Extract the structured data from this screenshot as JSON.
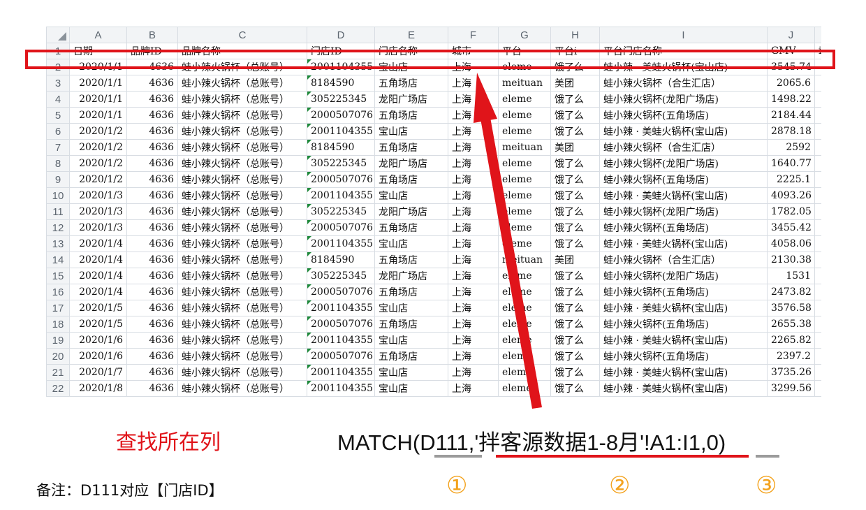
{
  "columns": [
    "A",
    "B",
    "C",
    "D",
    "E",
    "F",
    "G",
    "H",
    "I",
    "J"
  ],
  "header_row": {
    "num": "1",
    "cells": [
      "日期",
      "品牌ID",
      "品牌名称",
      "门店ID",
      "门店名称",
      "城市",
      "平台",
      "平台i",
      "平台门店名称",
      "GMV",
      "i"
    ]
  },
  "rows": [
    {
      "num": "2",
      "date": "2020/1/1",
      "brand_id": "4636",
      "brand": "蛙小辣火锅杯（总账号）",
      "store_id": "2001104355",
      "store": "宝山店",
      "city": "上海",
      "platform": "eleme",
      "platform_cn": "饿了么",
      "platform_store": "蛙小辣 · 美蛙火锅杯(宝山店)",
      "gmv": "3545.74"
    },
    {
      "num": "3",
      "date": "2020/1/1",
      "brand_id": "4636",
      "brand": "蛙小辣火锅杯（总账号）",
      "store_id": "8184590",
      "store": "五角场店",
      "city": "上海",
      "platform": "meituan",
      "platform_cn": "美团",
      "platform_store": "蛙小辣火锅杯（合生汇店）",
      "gmv": "2065.6"
    },
    {
      "num": "4",
      "date": "2020/1/1",
      "brand_id": "4636",
      "brand": "蛙小辣火锅杯（总账号）",
      "store_id": "305225345",
      "store": "龙阳广场店",
      "city": "上海",
      "platform": "eleme",
      "platform_cn": "饿了么",
      "platform_store": "蛙小辣火锅杯(龙阳广场店)",
      "gmv": "1498.22"
    },
    {
      "num": "5",
      "date": "2020/1/1",
      "brand_id": "4636",
      "brand": "蛙小辣火锅杯（总账号）",
      "store_id": "2000507076",
      "store": "五角场店",
      "city": "上海",
      "platform": "eleme",
      "platform_cn": "饿了么",
      "platform_store": "蛙小辣火锅杯(五角场店)",
      "gmv": "2184.44"
    },
    {
      "num": "6",
      "date": "2020/1/2",
      "brand_id": "4636",
      "brand": "蛙小辣火锅杯（总账号）",
      "store_id": "2001104355",
      "store": "宝山店",
      "city": "上海",
      "platform": "eleme",
      "platform_cn": "饿了么",
      "platform_store": "蛙小辣 · 美蛙火锅杯(宝山店)",
      "gmv": "2878.18"
    },
    {
      "num": "7",
      "date": "2020/1/2",
      "brand_id": "4636",
      "brand": "蛙小辣火锅杯（总账号）",
      "store_id": "8184590",
      "store": "五角场店",
      "city": "上海",
      "platform": "meituan",
      "platform_cn": "美团",
      "platform_store": "蛙小辣火锅杯（合生汇店）",
      "gmv": "2592"
    },
    {
      "num": "8",
      "date": "2020/1/2",
      "brand_id": "4636",
      "brand": "蛙小辣火锅杯（总账号）",
      "store_id": "305225345",
      "store": "龙阳广场店",
      "city": "上海",
      "platform": "eleme",
      "platform_cn": "饿了么",
      "platform_store": "蛙小辣火锅杯(龙阳广场店)",
      "gmv": "1640.77"
    },
    {
      "num": "9",
      "date": "2020/1/2",
      "brand_id": "4636",
      "brand": "蛙小辣火锅杯（总账号）",
      "store_id": "2000507076",
      "store": "五角场店",
      "city": "上海",
      "platform": "eleme",
      "platform_cn": "饿了么",
      "platform_store": "蛙小辣火锅杯(五角场店)",
      "gmv": "2225.1"
    },
    {
      "num": "10",
      "date": "2020/1/3",
      "brand_id": "4636",
      "brand": "蛙小辣火锅杯（总账号）",
      "store_id": "2001104355",
      "store": "宝山店",
      "city": "上海",
      "platform": "eleme",
      "platform_cn": "饿了么",
      "platform_store": "蛙小辣 · 美蛙火锅杯(宝山店)",
      "gmv": "4093.26"
    },
    {
      "num": "11",
      "date": "2020/1/3",
      "brand_id": "4636",
      "brand": "蛙小辣火锅杯（总账号）",
      "store_id": "305225345",
      "store": "龙阳广场店",
      "city": "上海",
      "platform": "eleme",
      "platform_cn": "饿了么",
      "platform_store": "蛙小辣火锅杯(龙阳广场店)",
      "gmv": "1782.05"
    },
    {
      "num": "12",
      "date": "2020/1/3",
      "brand_id": "4636",
      "brand": "蛙小辣火锅杯（总账号）",
      "store_id": "2000507076",
      "store": "五角场店",
      "city": "上海",
      "platform": "eleme",
      "platform_cn": "饿了么",
      "platform_store": "蛙小辣火锅杯(五角场店)",
      "gmv": "3455.42"
    },
    {
      "num": "13",
      "date": "2020/1/4",
      "brand_id": "4636",
      "brand": "蛙小辣火锅杯（总账号）",
      "store_id": "2001104355",
      "store": "宝山店",
      "city": "上海",
      "platform": "eleme",
      "platform_cn": "饿了么",
      "platform_store": "蛙小辣 · 美蛙火锅杯(宝山店)",
      "gmv": "4058.06"
    },
    {
      "num": "14",
      "date": "2020/1/4",
      "brand_id": "4636",
      "brand": "蛙小辣火锅杯（总账号）",
      "store_id": "8184590",
      "store": "五角场店",
      "city": "上海",
      "platform": "meituan",
      "platform_cn": "美团",
      "platform_store": "蛙小辣火锅杯（合生汇店）",
      "gmv": "2130.38"
    },
    {
      "num": "15",
      "date": "2020/1/4",
      "brand_id": "4636",
      "brand": "蛙小辣火锅杯（总账号）",
      "store_id": "305225345",
      "store": "龙阳广场店",
      "city": "上海",
      "platform": "eleme",
      "platform_cn": "饿了么",
      "platform_store": "蛙小辣火锅杯(龙阳广场店)",
      "gmv": "1531"
    },
    {
      "num": "16",
      "date": "2020/1/4",
      "brand_id": "4636",
      "brand": "蛙小辣火锅杯（总账号）",
      "store_id": "2000507076",
      "store": "五角场店",
      "city": "上海",
      "platform": "eleme",
      "platform_cn": "饿了么",
      "platform_store": "蛙小辣火锅杯(五角场店)",
      "gmv": "2473.82"
    },
    {
      "num": "17",
      "date": "2020/1/5",
      "brand_id": "4636",
      "brand": "蛙小辣火锅杯（总账号）",
      "store_id": "2001104355",
      "store": "宝山店",
      "city": "上海",
      "platform": "eleme",
      "platform_cn": "饿了么",
      "platform_store": "蛙小辣 · 美蛙火锅杯(宝山店)",
      "gmv": "3576.58"
    },
    {
      "num": "18",
      "date": "2020/1/5",
      "brand_id": "4636",
      "brand": "蛙小辣火锅杯（总账号）",
      "store_id": "2000507076",
      "store": "五角场店",
      "city": "上海",
      "platform": "eleme",
      "platform_cn": "饿了么",
      "platform_store": "蛙小辣火锅杯(五角场店)",
      "gmv": "2655.38"
    },
    {
      "num": "19",
      "date": "2020/1/6",
      "brand_id": "4636",
      "brand": "蛙小辣火锅杯（总账号）",
      "store_id": "2001104355",
      "store": "宝山店",
      "city": "上海",
      "platform": "eleme",
      "platform_cn": "饿了么",
      "platform_store": "蛙小辣 · 美蛙火锅杯(宝山店)",
      "gmv": "2265.82"
    },
    {
      "num": "20",
      "date": "2020/1/6",
      "brand_id": "4636",
      "brand": "蛙小辣火锅杯（总账号）",
      "store_id": "2000507076",
      "store": "五角场店",
      "city": "上海",
      "platform": "eleme",
      "platform_cn": "饿了么",
      "platform_store": "蛙小辣火锅杯(五角场店)",
      "gmv": "2397.2"
    },
    {
      "num": "21",
      "date": "2020/1/7",
      "brand_id": "4636",
      "brand": "蛙小辣火锅杯（总账号）",
      "store_id": "2001104355",
      "store": "宝山店",
      "city": "上海",
      "platform": "eleme",
      "platform_cn": "饿了么",
      "platform_store": "蛙小辣 · 美蛙火锅杯(宝山店)",
      "gmv": "3735.26"
    },
    {
      "num": "22",
      "date": "2020/1/8",
      "brand_id": "4636",
      "brand": "蛙小辣火锅杯（总账号）",
      "store_id": "2001104355",
      "store": "宝山店",
      "city": "上海",
      "platform": "eleme",
      "platform_cn": "饿了么",
      "platform_store": "蛙小辣 · 美蛙火锅杯(宝山店)",
      "gmv": "3299.56"
    }
  ],
  "annotation": {
    "caption": "查找所在列",
    "formula": "MATCH(D111,'拌客源数据1-8月'!A1:I1,0)",
    "markers": [
      "①",
      "②",
      "③"
    ],
    "note": "备注：D111对应【门店ID】",
    "highlight_color": "#e0141a",
    "marker_color": "#f3a21c"
  }
}
